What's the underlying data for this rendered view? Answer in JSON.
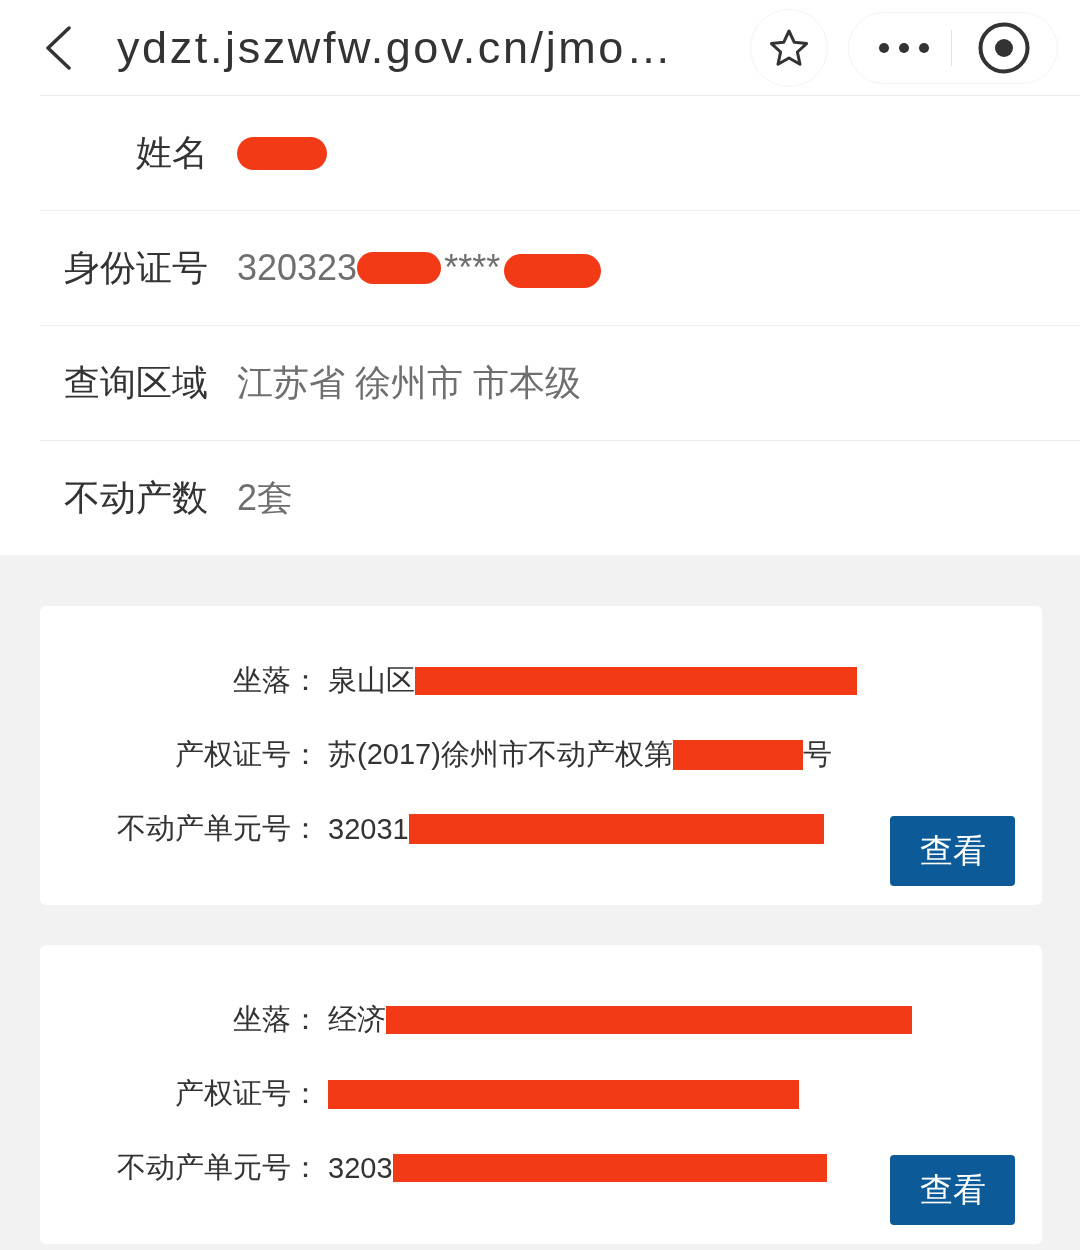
{
  "browser_bar": {
    "url": "ydzt.jszwfw.gov.cn/jmo…"
  },
  "info": [
    {
      "label": "姓名",
      "value": [
        {
          "kind": "redaction"
        }
      ]
    },
    {
      "label": "身份证号",
      "value": [
        {
          "kind": "text",
          "text": "320323"
        },
        {
          "kind": "redaction"
        },
        {
          "kind": "text",
          "text": "****"
        },
        {
          "kind": "redaction"
        }
      ]
    },
    {
      "label": "查询区域",
      "value": [
        {
          "kind": "text",
          "text": "江苏省 徐州市 市本级"
        }
      ]
    },
    {
      "label": "不动产数",
      "value": [
        {
          "kind": "text",
          "text": "2套"
        }
      ]
    }
  ],
  "properties": [
    {
      "fields": [
        {
          "label": "坐落：",
          "value": [
            {
              "kind": "text",
              "text": "泉山区"
            },
            {
              "kind": "redaction"
            }
          ]
        },
        {
          "label": "产权证号：",
          "value": [
            {
              "kind": "text",
              "text": "苏(2017)徐州市不动产权第"
            },
            {
              "kind": "redaction"
            },
            {
              "kind": "text",
              "text": "号"
            }
          ]
        },
        {
          "label": "不动产单元号：",
          "value": [
            {
              "kind": "text",
              "text": "32031"
            },
            {
              "kind": "redaction"
            }
          ]
        }
      ],
      "button": "查看"
    },
    {
      "fields": [
        {
          "label": "坐落：",
          "value": [
            {
              "kind": "text",
              "text": "经济"
            },
            {
              "kind": "redaction"
            }
          ]
        },
        {
          "label": "产权证号：",
          "value": [
            {
              "kind": "redaction"
            }
          ]
        },
        {
          "label": "不动产单元号：",
          "value": [
            {
              "kind": "text",
              "text": "3203"
            },
            {
              "kind": "redaction"
            }
          ]
        }
      ],
      "button": "查看"
    }
  ]
}
